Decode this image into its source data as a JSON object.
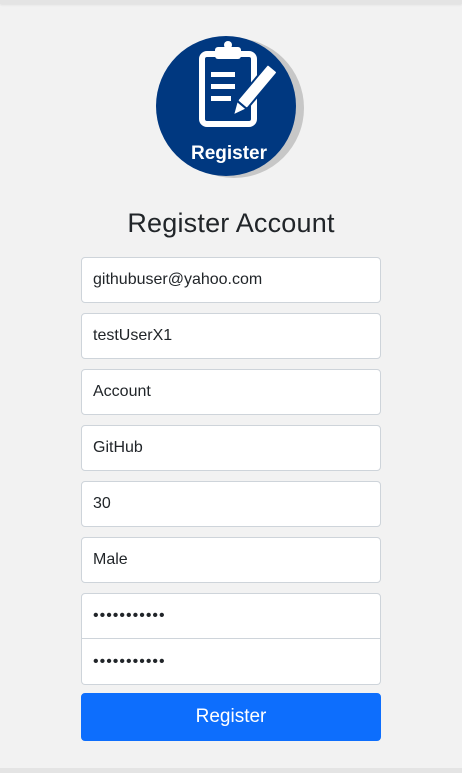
{
  "logo": {
    "label": "Register",
    "colors": {
      "circle": "#003880",
      "shadow": "#c7c7c7",
      "icon": "#ffffff"
    },
    "icon": "clipboard-pencil-icon"
  },
  "heading": "Register Account",
  "form": {
    "email": "githubuser@yahoo.com",
    "username": "testUserX1",
    "first_name": "Account",
    "last_name": "GitHub",
    "age": "30",
    "gender": "Male",
    "password": "•••••••••••",
    "confirm_password": "•••••••••••"
  },
  "submit_label": "Register",
  "colors": {
    "accent": "#0d6efd",
    "background": "#f2f2f2"
  }
}
